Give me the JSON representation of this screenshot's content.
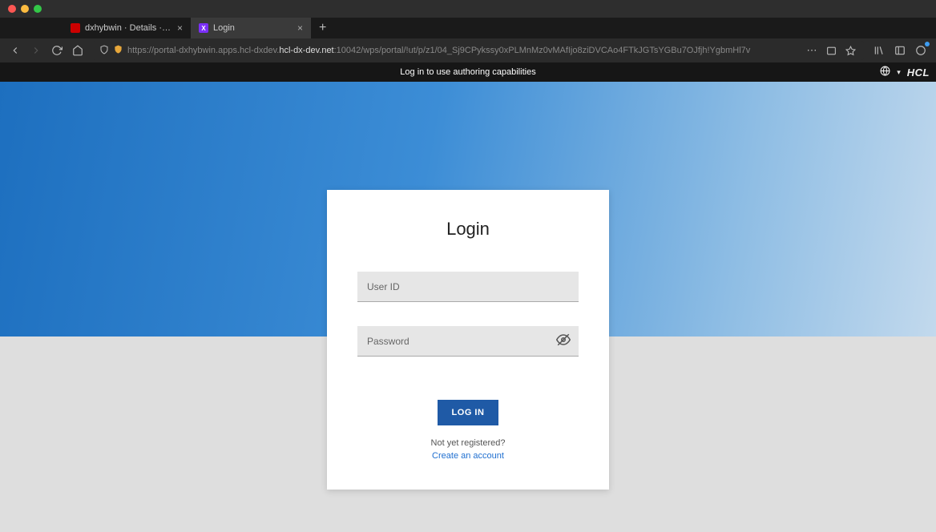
{
  "tabs": {
    "tab1": {
      "label": "dxhybwin · Details · Red Hat O…"
    },
    "tab2": {
      "label": "Login"
    }
  },
  "urlbar": {
    "prefix": "https://portal-dxhybwin.apps.hcl-dxdev.",
    "domain": "hcl-dx-dev.net",
    "suffix": ":10042/wps/portal/!ut/p/z1/04_Sj9CPykssy0xPLMnMz0vMAfIjo8ziDVCAo4FTkJGTsYGBu7OJfjh!YgbmHl7v"
  },
  "notice_bar": {
    "text": "Log in to use authoring capabilities",
    "brand": "HCL"
  },
  "login": {
    "title": "Login",
    "user_id_placeholder": "User ID",
    "password_placeholder": "Password",
    "button_label": "LOG IN",
    "not_registered": "Not yet registered?",
    "create_account": "Create an account"
  }
}
